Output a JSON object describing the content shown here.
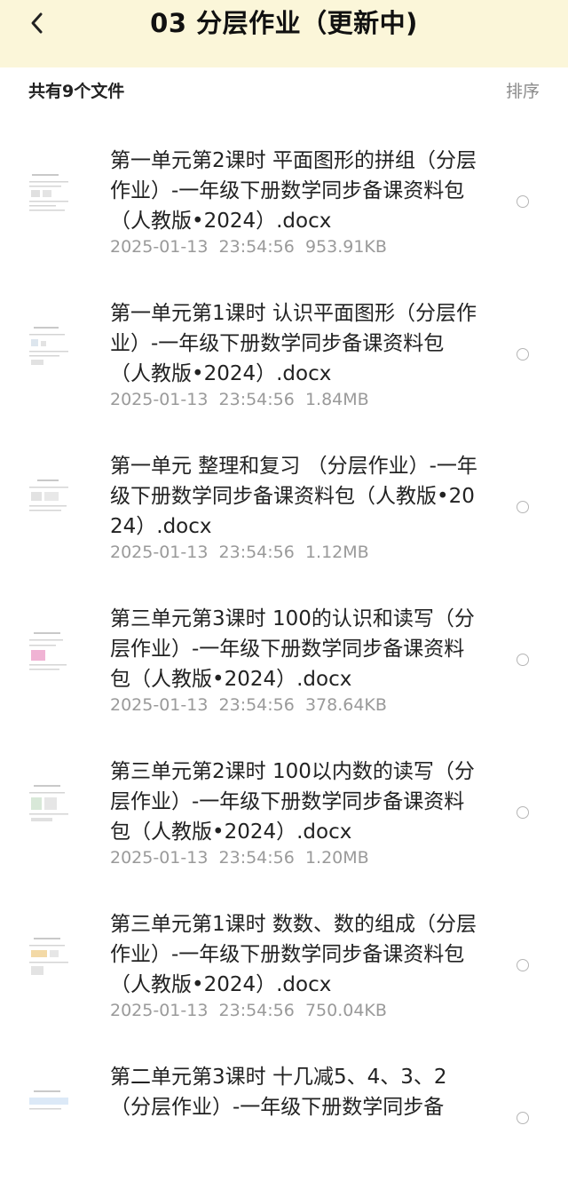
{
  "header": {
    "title": "03 分层作业（更新中)"
  },
  "subbar": {
    "file_count": "共有9个文件",
    "sort_label": "排序"
  },
  "files": [
    {
      "name": "第一单元第2课时 平面图形的拼组（分层作业）-一年级下册数学同步备课资料包（人教版•2024）.docx",
      "date": "2025-01-13",
      "time": "23:54:56",
      "size": "953.91KB"
    },
    {
      "name": "第一单元第1课时 认识平面图形（分层作业）-一年级下册数学同步备课资料包（人教版•2024）.docx",
      "date": "2025-01-13",
      "time": "23:54:56",
      "size": "1.84MB"
    },
    {
      "name": "第一单元 整理和复习 （分层作业）-一年级下册数学同步备课资料包（人教版•2024）.docx",
      "date": "2025-01-13",
      "time": "23:54:56",
      "size": "1.12MB"
    },
    {
      "name": "第三单元第3课时 100的认识和读写（分层作业）-一年级下册数学同步备课资料包（人教版•2024）.docx",
      "date": "2025-01-13",
      "time": "23:54:56",
      "size": "378.64KB"
    },
    {
      "name": "第三单元第2课时 100以内数的读写（分层作业）-一年级下册数学同步备课资料包（人教版•2024）.docx",
      "date": "2025-01-13",
      "time": "23:54:56",
      "size": "1.20MB"
    },
    {
      "name": "第三单元第1课时 数数、数的组成（分层作业）-一年级下册数学同步备课资料包（人教版•2024）.docx",
      "date": "2025-01-13",
      "time": "23:54:56",
      "size": "750.04KB"
    },
    {
      "name": "第二单元第3课时 十几减5、4、3、2（分层作业）-一年级下册数学同步备",
      "date": "",
      "time": "",
      "size": ""
    }
  ],
  "colors": {
    "header_bg": "#fbf6d9",
    "meta_text": "#9a9a9a",
    "sort_text": "#8a8a8a"
  },
  "icons": {
    "back": "chevron-left-icon",
    "radio": "radio-unchecked-icon",
    "thumb": "document-thumbnail"
  }
}
